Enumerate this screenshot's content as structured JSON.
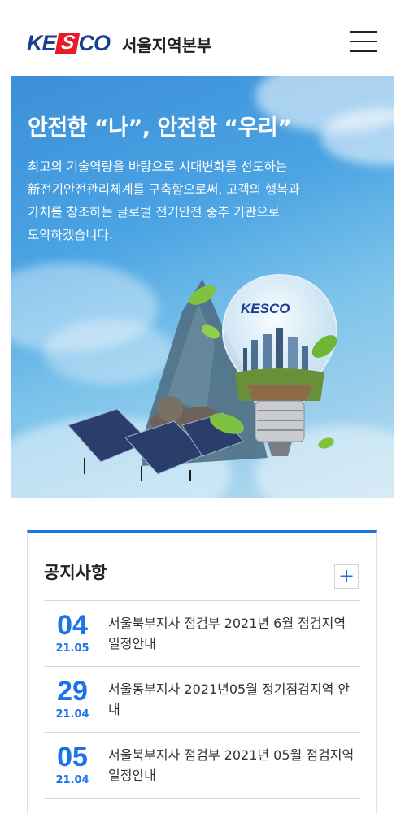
{
  "header": {
    "logo_prefix": "KE",
    "logo_s": "S",
    "logo_suffix": "CO",
    "site_title": "서울지역본부"
  },
  "hero": {
    "title": "안전한 “나”, 안전한 “우리”",
    "desc_lines": [
      "최고의 기술역량을 바탕으로 시대변화를 선도하는",
      "新전기안전관리체계를 구축함으로써, 고객의 행복과",
      "가치를 창조하는 글로벌 전기안전 중추 기관으로",
      "도약하겠습니다."
    ],
    "bulb_logo": "KESCO"
  },
  "notice": {
    "title": "공지사항",
    "more_label": "+",
    "items": [
      {
        "day": "04",
        "ym": "21.05",
        "subject": "서울북부지사 점검부 2021년 6월 점검지역 일정안내"
      },
      {
        "day": "29",
        "ym": "21.04",
        "subject": "서울동부지사 2021년05월 정기점검지역 안내"
      },
      {
        "day": "05",
        "ym": "21.04",
        "subject": "서울북부지사 점검부 2021년 05월 점검지역 일정안내"
      }
    ]
  },
  "colors": {
    "brand_blue": "#1a73e8",
    "logo_navy": "#1a3f8f",
    "logo_red": "#e51d2a"
  }
}
